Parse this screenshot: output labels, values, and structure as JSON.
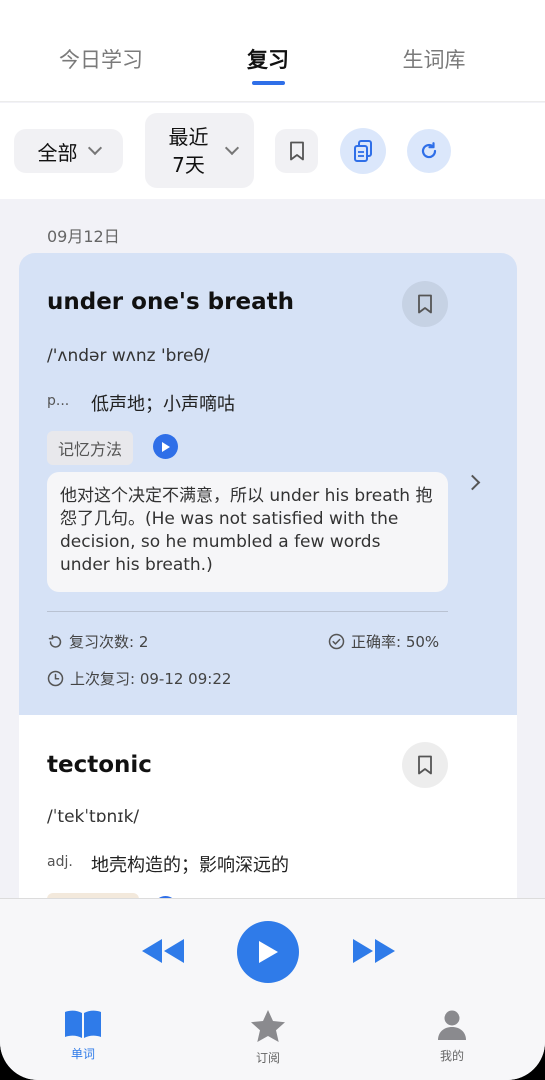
{
  "top_tabs": [
    {
      "label": "今日学习",
      "active": false
    },
    {
      "label": "复习",
      "active": true
    },
    {
      "label": "生词库",
      "active": false
    }
  ],
  "filters": {
    "scope_label": "全部",
    "range_line1": "最近",
    "range_line2": "7天"
  },
  "list": {
    "date_label": "09月12日",
    "cards": [
      {
        "word": "under one's breath",
        "phonetic": "/'ʌndər wʌnz 'breθ/",
        "pos": "p...",
        "meaning": "低声地；小声嘀咕",
        "tag_label": "记忆方法",
        "example": "他对这个决定不满意，所以 under his breath 抱怨了几句。(He was not satisfied with the decision, so he mumbled a few words under his breath.)",
        "review_count": "复习次数: 2",
        "accuracy": "正确率: 50%",
        "last_review": "上次复习: 09-12 09:22"
      },
      {
        "word": "tectonic",
        "phonetic": "/ˈtekˈtɒnɪk/",
        "pos": "adj.",
        "meaning": "地壳构造的；影响深远的"
      }
    ]
  },
  "bottom_nav": [
    {
      "label": "单词",
      "icon": "book-icon",
      "active": true
    },
    {
      "label": "订阅",
      "icon": "star-icon",
      "active": false
    },
    {
      "label": "我的",
      "icon": "person-icon",
      "active": false
    }
  ],
  "colors": {
    "accent": "#2f6fe8",
    "card_highlight": "#d6e2f6"
  }
}
